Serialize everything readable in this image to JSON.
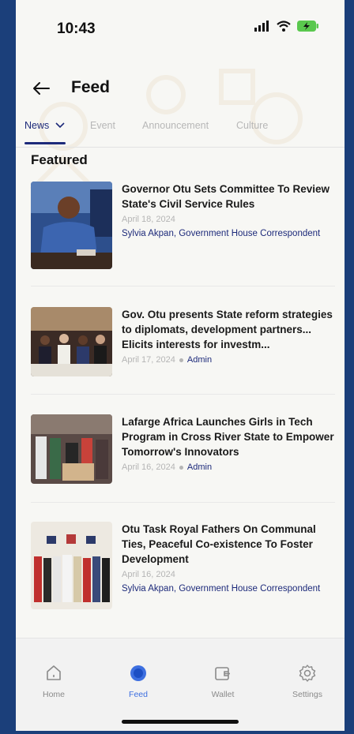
{
  "status_bar": {
    "time": "10:43"
  },
  "header": {
    "title": "Feed"
  },
  "tabs": [
    {
      "label": "News"
    },
    {
      "label": "Event"
    },
    {
      "label": "Announcement"
    },
    {
      "label": "Culture"
    }
  ],
  "section": {
    "featured": "Featured"
  },
  "articles": [
    {
      "headline": "Governor Otu Sets Committee To Review State's Civil Service Rules",
      "date": "April 18, 2024",
      "author": "Sylvia Akpan, Government House Correspondent"
    },
    {
      "headline": "Gov. Otu presents State reform strategies to diplomats, development partners... Elicits interests for investm...",
      "date": "April 17, 2024",
      "author": "Admin"
    },
    {
      "headline": "Lafarge Africa Launches Girls in Tech Program in Cross River State to Empower Tomorrow's Innovators",
      "date": "April 16, 2024",
      "author": "Admin"
    },
    {
      "headline": "Otu Task Royal Fathers On Communal Ties, Peaceful Co-existence To Foster Development",
      "date": "April 16, 2024",
      "author": "Sylvia Akpan, Government House Correspondent"
    }
  ],
  "nav": [
    {
      "label": "Home",
      "icon": "home-icon"
    },
    {
      "label": "Feed",
      "icon": "feed-icon"
    },
    {
      "label": "Wallet",
      "icon": "wallet-icon"
    },
    {
      "label": "Settings",
      "icon": "settings-icon"
    }
  ],
  "colors": {
    "accent": "#1d2a7a",
    "active_nav": "#3d6fe0",
    "frame": "#1b3f7a"
  }
}
